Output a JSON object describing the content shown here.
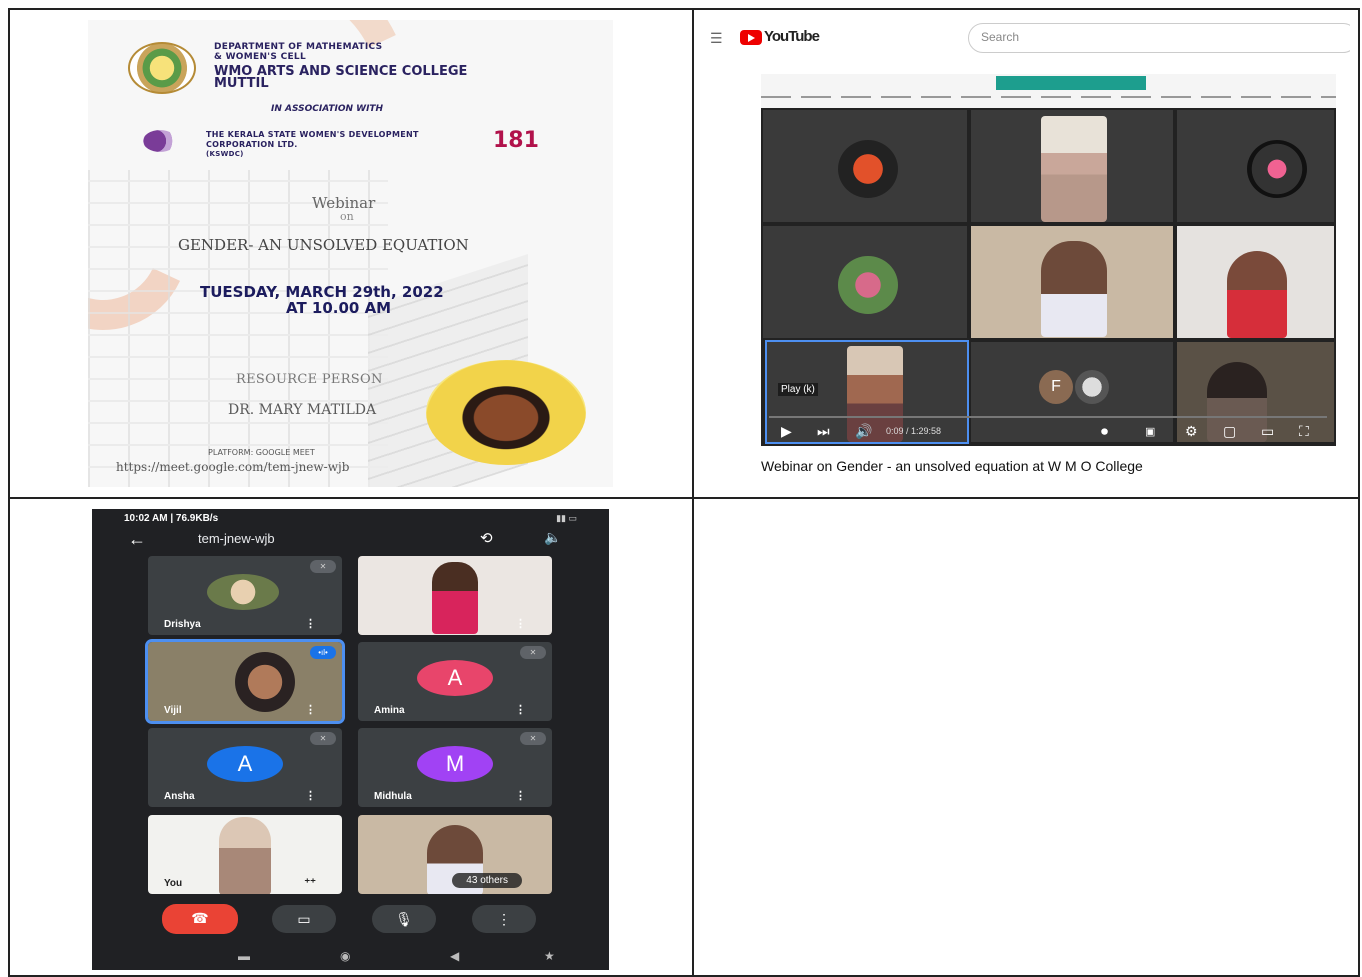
{
  "poster": {
    "dept": "DEPARTMENT OF MATHEMATICS",
    "cell": "& WOMEN'S CELL",
    "college_line1": "WMO ARTS AND SCIENCE COLLEGE",
    "college_line2": "MUTTIL",
    "assoc": "IN ASSOCIATION WITH",
    "corp_line1": "THE KERALA STATE WOMEN'S DEVELOPMENT",
    "corp_line2": "CORPORATION LTD.",
    "corp_line3": "(KSWDC)",
    "helpline": "181",
    "webinar": "Webinar",
    "on": "on",
    "topic": "GENDER- AN UNSOLVED EQUATION",
    "date_line1": "TUESDAY, MARCH 29th, 2022",
    "date_line2": "AT 10.00 AM",
    "resource_label": "RESOURCE PERSON",
    "resource_name": "DR. MARY MATILDA",
    "platform": "PLATFORM: GOOGLE MEET",
    "link": "https://meet.google.com/tem-jnew-wjb"
  },
  "youtube": {
    "menu_icon": "hamburger-icon",
    "logo": "YouTube",
    "search_placeholder": "Search",
    "play_hint": "Play (k)",
    "time": "0:09 / 1:29:58",
    "video_title": "Webinar on Gender - an unsolved equation at W M O College",
    "tile_letter": "F"
  },
  "meet": {
    "status_time": "10:02 AM | 76.9KB/s",
    "meeting_code": "tem-jnew-wjb",
    "participants": [
      {
        "name": "Drishya"
      },
      {
        "name": ""
      },
      {
        "name": "Vijil"
      },
      {
        "name": "Amina",
        "initial": "A",
        "color": "#e8456b"
      },
      {
        "name": "Ansha",
        "initial": "A",
        "color": "#1a73e8"
      },
      {
        "name": "Midhula",
        "initial": "M",
        "color": "#a142f4"
      },
      {
        "name": "You"
      },
      {
        "name": ""
      }
    ],
    "others": "43 others"
  }
}
